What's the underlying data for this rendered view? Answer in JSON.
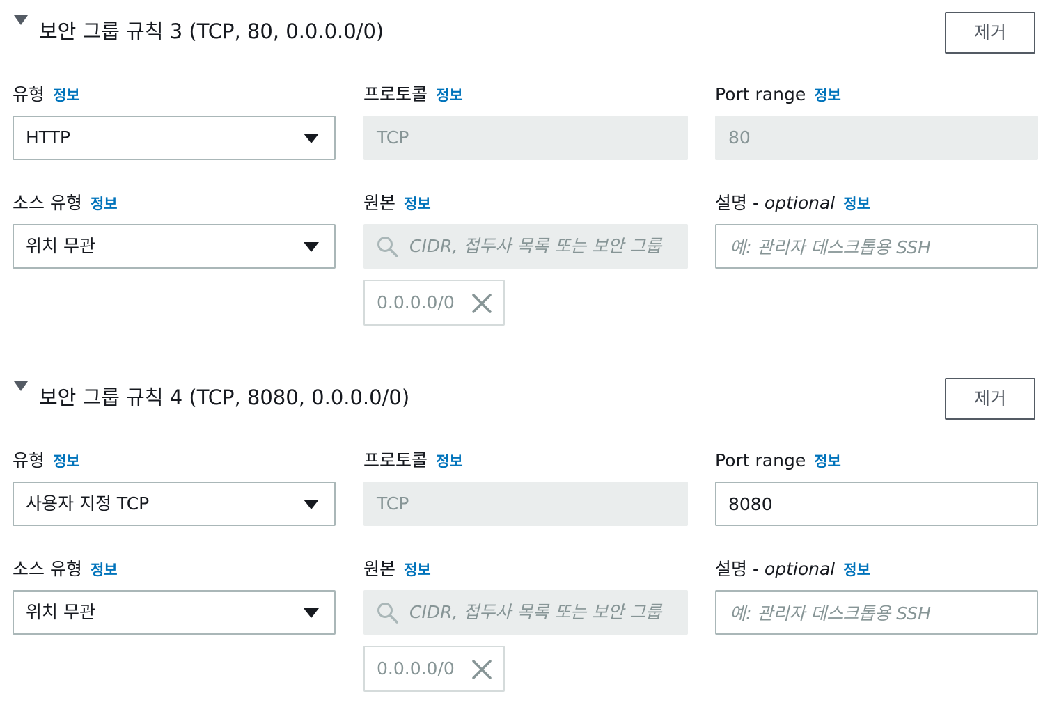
{
  "labels": {
    "type": "유형",
    "protocol": "프로토콜",
    "port_range": "Port range",
    "source_type": "소스 유형",
    "source": "원본",
    "description": "설명 - ",
    "optional": "optional",
    "info": "정보",
    "remove": "제거",
    "source_search_placeholder": "CIDR, 접두사 목록 또는 보안 그룹",
    "description_placeholder": "예: 관리자 데스크톱용 SSH"
  },
  "rules": [
    {
      "title": "보안 그룹 규칙 3 (TCP, 80, 0.0.0.0/0)",
      "type": "HTTP",
      "protocol": "TCP",
      "port_range": "80",
      "port_range_editable": false,
      "source_type": "위치 무관",
      "source_token": "0.0.0.0/0"
    },
    {
      "title": "보안 그룹 규칙 4 (TCP, 8080, 0.0.0.0/0)",
      "type": "사용자 지정 TCP",
      "protocol": "TCP",
      "port_range": "8080",
      "port_range_editable": true,
      "source_type": "위치 무관",
      "source_token": "0.0.0.0/0"
    }
  ],
  "colors": {
    "link": "#0073bb",
    "text": "#16191f",
    "border": "#aab7b8",
    "disabled_bg": "#eaeded",
    "placeholder": "#879596"
  },
  "icons": {
    "expand": "caret-down-icon",
    "dropdown": "dropdown-arrow-icon",
    "search": "search-icon",
    "token_remove": "close-icon"
  }
}
